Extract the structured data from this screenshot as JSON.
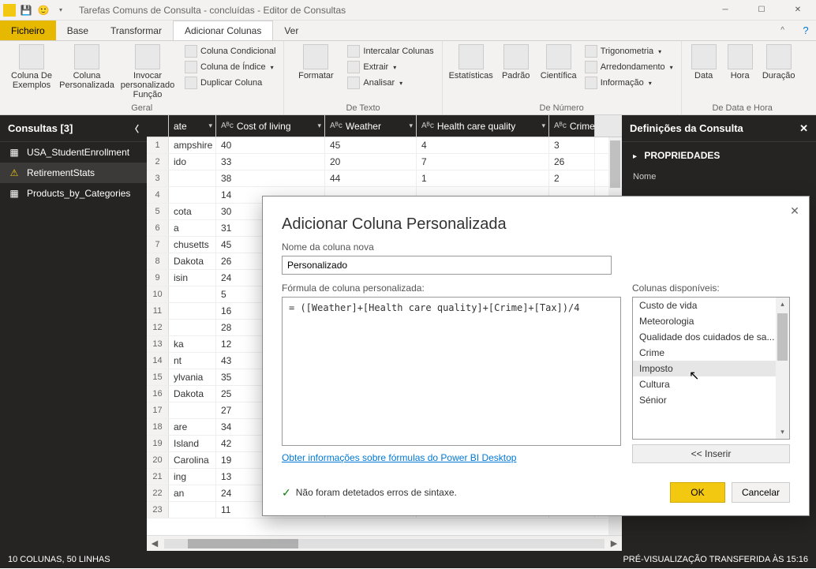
{
  "titlebar": {
    "title": "Tarefas Comuns de Consulta - concluídas - Editor de Consultas"
  },
  "menu": {
    "file": "Ficheiro",
    "base": "Base",
    "transform": "Transformar",
    "addcol": "Adicionar Colunas",
    "view": "Ver"
  },
  "ribbon": {
    "g1": {
      "b1": "Coluna De Exemplos",
      "b2": "Coluna Personalizada",
      "b3": "Invocar personalizado Função",
      "s1": "Coluna Condicional",
      "s2": "Coluna de Índice",
      "s3": "Duplicar Coluna",
      "label": "Geral"
    },
    "g2": {
      "b1": "Formatar",
      "s1": "Intercalar Colunas",
      "s2": "Extrair",
      "s3": "Analisar",
      "label": "De Texto"
    },
    "g3": {
      "b1": "Estatísticas",
      "b2": "Padrão",
      "b3": "Científica",
      "s1": "Trigonometria",
      "s2": "Arredondamento",
      "s3": "Informação",
      "label": "De Número"
    },
    "g4": {
      "b1": "Data",
      "b2": "Hora",
      "b3": "Duração",
      "label": "De Data e Hora"
    }
  },
  "left": {
    "title": "Consultas [3]",
    "items": [
      "USA_StudentEnrollment",
      "RetirementStats",
      "Products_by_Categories"
    ]
  },
  "grid": {
    "cols": [
      "ate",
      "Cost of living",
      "Weather",
      "Health care quality",
      "Crime"
    ],
    "rows": [
      {
        "n": 1,
        "c": [
          "ampshire",
          "40",
          "45",
          "4",
          "3"
        ]
      },
      {
        "n": 2,
        "c": [
          "ido",
          "33",
          "20",
          "7",
          "26"
        ]
      },
      {
        "n": 3,
        "c": [
          "",
          "38",
          "44",
          "1",
          "2"
        ]
      },
      {
        "n": 4,
        "c": [
          "",
          "14",
          "",
          "",
          ""
        ]
      },
      {
        "n": 5,
        "c": [
          "cota",
          "30",
          "",
          "",
          ""
        ]
      },
      {
        "n": 6,
        "c": [
          "a",
          "31",
          "",
          "",
          ""
        ]
      },
      {
        "n": 7,
        "c": [
          "chusetts",
          "45",
          "",
          "",
          ""
        ]
      },
      {
        "n": 8,
        "c": [
          "Dakota",
          "26",
          "",
          "",
          ""
        ]
      },
      {
        "n": 9,
        "c": [
          "isin",
          "24",
          "",
          "",
          ""
        ]
      },
      {
        "n": 10,
        "c": [
          "",
          "5",
          "",
          "",
          ""
        ]
      },
      {
        "n": 11,
        "c": [
          "",
          "16",
          "",
          "",
          ""
        ]
      },
      {
        "n": 12,
        "c": [
          "",
          "28",
          "",
          "",
          ""
        ]
      },
      {
        "n": 13,
        "c": [
          "ka",
          "12",
          "",
          "",
          ""
        ]
      },
      {
        "n": 14,
        "c": [
          "nt",
          "43",
          "",
          "",
          ""
        ]
      },
      {
        "n": 15,
        "c": [
          "ylvania",
          "35",
          "",
          "",
          ""
        ]
      },
      {
        "n": 16,
        "c": [
          "Dakota",
          "25",
          "",
          "",
          ""
        ]
      },
      {
        "n": 17,
        "c": [
          "",
          "27",
          "",
          "",
          ""
        ]
      },
      {
        "n": 18,
        "c": [
          "are",
          "34",
          "",
          "",
          ""
        ]
      },
      {
        "n": 19,
        "c": [
          "Island",
          "42",
          "",
          "",
          ""
        ]
      },
      {
        "n": 20,
        "c": [
          "Carolina",
          "19",
          "",
          "",
          ""
        ]
      },
      {
        "n": 21,
        "c": [
          "ing",
          "13",
          "",
          "",
          ""
        ]
      },
      {
        "n": 22,
        "c": [
          "an",
          "24",
          "",
          "",
          ""
        ]
      },
      {
        "n": 23,
        "c": [
          "",
          "11",
          "",
          "",
          ""
        ]
      }
    ]
  },
  "right": {
    "title": "Definições da Consulta",
    "section1": "PROPRIEDADES",
    "label1": "Nome"
  },
  "status": {
    "left": "10 COLUNAS, 50 LINHAS",
    "right": "PRÉ-VISUALIZAÇÃO TRANSFERIDA ÀS 15:16"
  },
  "dialog": {
    "title": "Adicionar Coluna Personalizada",
    "name_label": "Nome da coluna nova",
    "name_value": "Personalizado",
    "formula_label": "Fórmula de coluna personalizada:",
    "formula_value": "= ([Weather]+[Health care quality]+[Crime]+[Tax])/4",
    "avail_label": "Colunas disponíveis:",
    "avail": [
      "Custo de vida",
      "Meteorologia",
      "Qualidade dos cuidados de sa...",
      "Crime",
      "Imposto",
      "Cultura",
      "Sénior"
    ],
    "insert": "<< Inserir",
    "link": "Obter informações sobre fórmulas do Power BI Desktop",
    "status_ok": "Não foram detetados erros de sintaxe.",
    "ok": "OK",
    "cancel": "Cancelar"
  }
}
